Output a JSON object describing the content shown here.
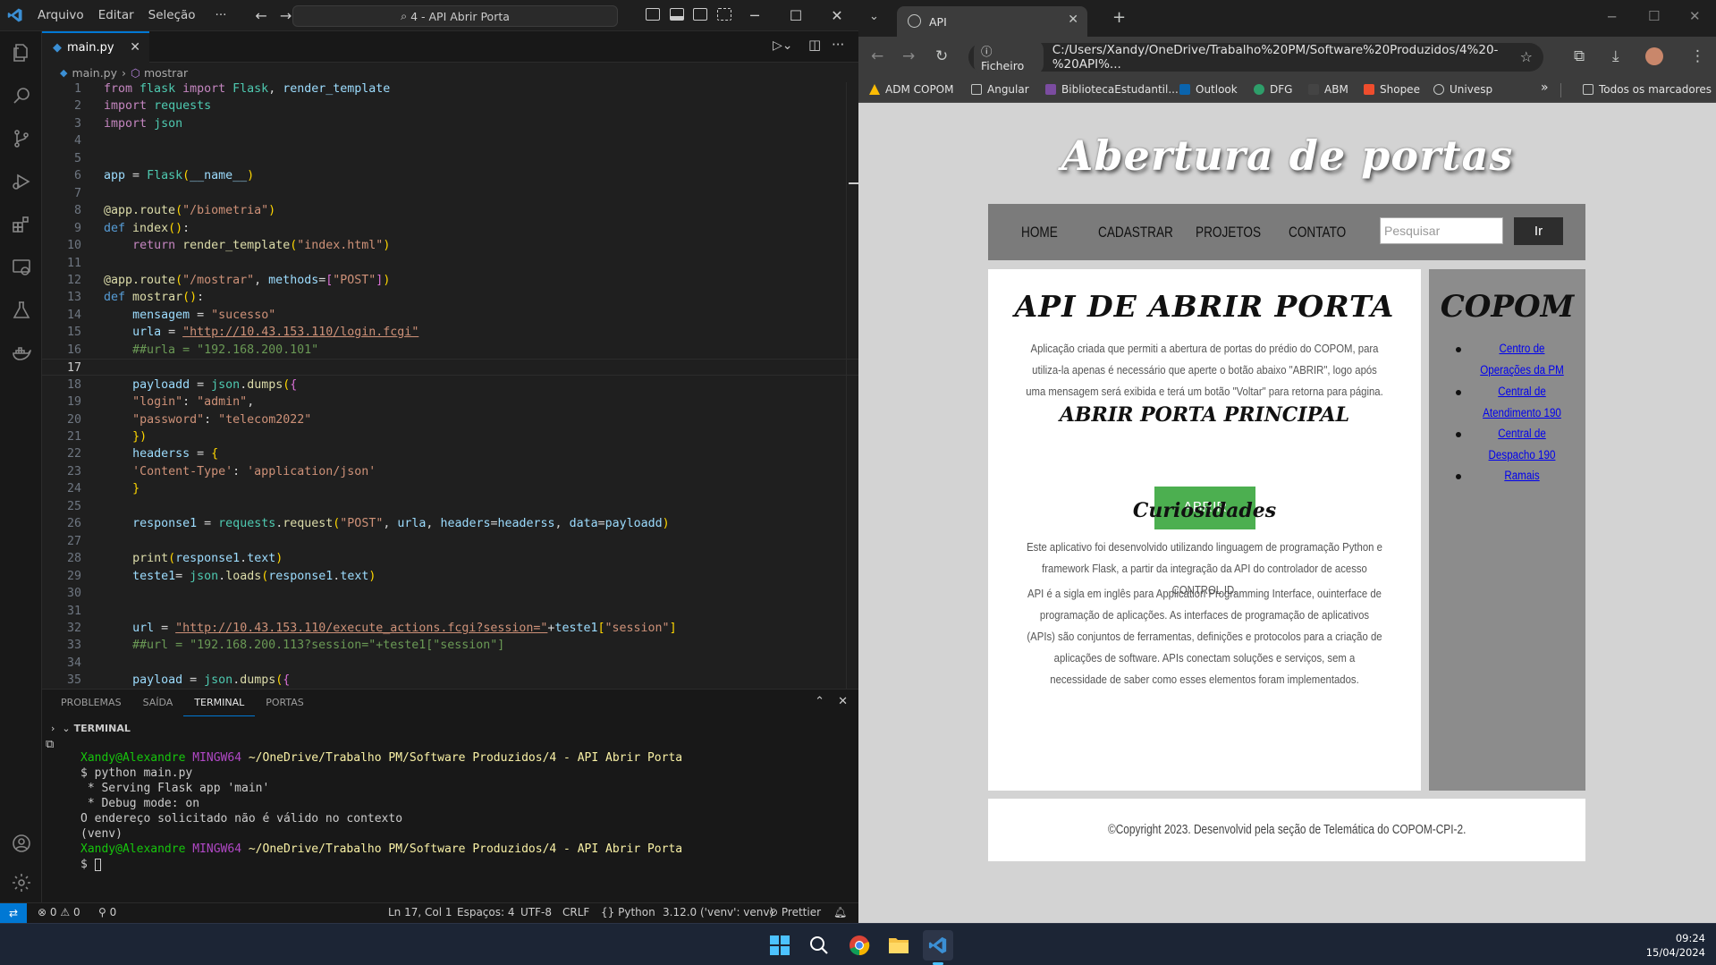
{
  "vscode": {
    "menu": [
      "Arquivo",
      "Editar",
      "Seleção",
      "···"
    ],
    "command_center": "4 - API Abrir Porta",
    "tab": {
      "filename": "main.py",
      "file_icon": "python-icon"
    },
    "breadcrumb": {
      "file": "main.py",
      "symbol": "mostrar"
    },
    "code": [
      {
        "n": "1",
        "t": "from flask import Flask, render_template"
      },
      {
        "n": "2",
        "t": "import requests"
      },
      {
        "n": "3",
        "t": "import json"
      },
      {
        "n": "4",
        "t": ""
      },
      {
        "n": "5",
        "t": ""
      },
      {
        "n": "6",
        "t": "app = Flask(__name__)"
      },
      {
        "n": "7",
        "t": ""
      },
      {
        "n": "8",
        "t": "@app.route(\"/biometria\")"
      },
      {
        "n": "9",
        "t": "def index():"
      },
      {
        "n": "10",
        "t": "    return render_template(\"index.html\")"
      },
      {
        "n": "11",
        "t": ""
      },
      {
        "n": "12",
        "t": "@app.route(\"/mostrar\", methods=[\"POST\"])"
      },
      {
        "n": "13",
        "t": "def mostrar():"
      },
      {
        "n": "14",
        "t": "    mensagem = \"sucesso\""
      },
      {
        "n": "15",
        "t": "    urla = \"http://10.43.153.110/login.fcgi\""
      },
      {
        "n": "16",
        "t": "    ##urla = \"192.168.200.101\""
      },
      {
        "n": "17",
        "t": ""
      },
      {
        "n": "18",
        "t": "    payloadd = json.dumps({"
      },
      {
        "n": "19",
        "t": "    \"login\": \"admin\","
      },
      {
        "n": "20",
        "t": "    \"password\": \"telecom2022\""
      },
      {
        "n": "21",
        "t": "    })"
      },
      {
        "n": "22",
        "t": "    headerss = {"
      },
      {
        "n": "23",
        "t": "    'Content-Type': 'application/json'"
      },
      {
        "n": "24",
        "t": "    }"
      },
      {
        "n": "25",
        "t": ""
      },
      {
        "n": "26",
        "t": "    response1 = requests.request(\"POST\", urla, headers=headerss, data=payloadd)"
      },
      {
        "n": "27",
        "t": ""
      },
      {
        "n": "28",
        "t": "    print(response1.text)"
      },
      {
        "n": "29",
        "t": "    teste1= json.loads(response1.text)"
      },
      {
        "n": "30",
        "t": ""
      },
      {
        "n": "31",
        "t": ""
      },
      {
        "n": "32",
        "t": "    url = \"http://10.43.153.110/execute_actions.fcgi?session=\"+teste1[\"session\"]"
      },
      {
        "n": "33",
        "t": "    ##url = \"192.168.200.113?session=\"+teste1[\"session\"]"
      },
      {
        "n": "34",
        "t": ""
      },
      {
        "n": "35",
        "t": "    payload = json.dumps({"
      }
    ],
    "panel_tabs": [
      "PROBLEMAS",
      "SAÍDA",
      "TERMINAL",
      "PORTAS"
    ],
    "terminal_header": "TERMINAL",
    "terminal": {
      "user": "Xandy@Alexandre",
      "shell": "MINGW64",
      "path": "~/OneDrive/Trabalho PM/Software Produzidos/4 - API Abrir Porta",
      "lines": [
        "$ python main.py",
        " * Serving Flask app 'main'",
        " * Debug mode: on",
        "O endereço solicitado não é válido no contexto",
        "(venv)"
      ],
      "prompt": "$ "
    },
    "status": {
      "errors": "0",
      "warnings": "0",
      "ports": "0",
      "position": "Ln 17, Col 1",
      "spaces": "Espaços: 4",
      "encoding": "UTF-8",
      "eol": "CRLF",
      "language": "Python",
      "interpreter": "3.12.0 ('venv': venv)",
      "formatter": "Prettier"
    }
  },
  "chrome": {
    "tab_title": "API",
    "omnibox_chip": "Ficheiro",
    "url": "C:/Users/Xandy/OneDrive/Trabalho%20PM/Software%20Produzidos/4%20-%20API%...",
    "bookmarks": [
      "ADM COPOM",
      "Angular",
      "BibliotecaEstudantil...",
      "Outlook",
      "DFG",
      "ABM",
      "Shopee",
      "Univesp"
    ],
    "bookmarks_more": "»",
    "all_bookmarks": "Todos os marcadores"
  },
  "site": {
    "title": "Abertura de portas",
    "nav": [
      "HOME",
      "CADASTRAR",
      "PROJETOS",
      "CONTATO"
    ],
    "search_placeholder": "Pesquisar",
    "search_button": "Ir",
    "main_title": "API DE ABRIR PORTA",
    "intro": "Aplicação criada que permiti a abertura de portas do prédio do COPOM, para utiliza-la apenas é necessário que aperte o botão abaixo \"ABRIR\", logo após uma mensagem será exibida e terá um botão \"Voltar\" para retorna para página.",
    "section_title": "ABRIR PORTA PRINCIPAL",
    "open_button": "ABRIR",
    "curiosities_title": "Curiosidades",
    "curiosities_p1": "Este aplicativo foi desenvolvido utilizando linguagem de programação Python e framework Flask, a partir da integração da API do controlador de acesso CONTROL ID.",
    "curiosities_p2": "API é a sigla em inglês para Application Programming Interface, ouinterface de programação de aplicações. As interfaces de programação de aplicativos (APIs) são conjuntos de ferramentas, definições e protocolos para a criação de aplicações de software. APIs conectam soluções e serviços, sem a necessidade de saber como esses elementos foram implementados.",
    "side_title": "COPOM",
    "side_links": [
      "Centro de Operações da PM",
      "Central de Atendimento 190",
      "Central de Despacho 190",
      "Ramais"
    ],
    "footer": "©Copyright 2023. Desenvolvid pela seção de Telemática do COPOM-CPI-2."
  },
  "taskbar": {
    "time": "09:24",
    "date": "15/04/2024"
  }
}
